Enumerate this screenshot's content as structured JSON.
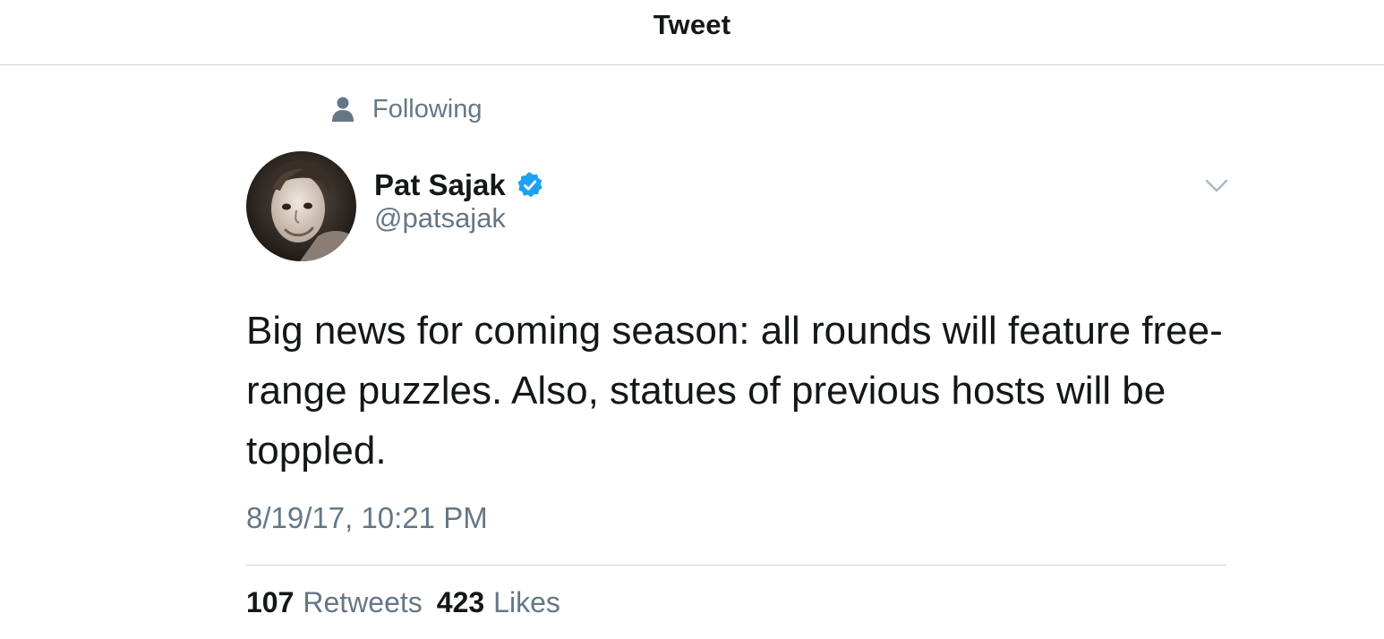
{
  "header": {
    "title": "Tweet"
  },
  "social_context": {
    "label": "Following",
    "icon": "person-icon"
  },
  "author": {
    "name": "Pat Sajak",
    "handle": "@patsajak",
    "verified": true,
    "avatar": "avatar-photo"
  },
  "tweet": {
    "text": "Big news for coming season: all rounds will feature free-range puzzles. Also, statues of previous hosts will be toppled.",
    "timestamp": "8/19/17, 10:21 PM"
  },
  "stats": {
    "retweets_count": "107",
    "retweets_label": "Retweets",
    "likes_count": "423",
    "likes_label": "Likes"
  },
  "colors": {
    "text_primary": "#14171a",
    "text_secondary": "#657786",
    "verified_blue": "#1da1f2",
    "divider": "#cfd4d9"
  }
}
